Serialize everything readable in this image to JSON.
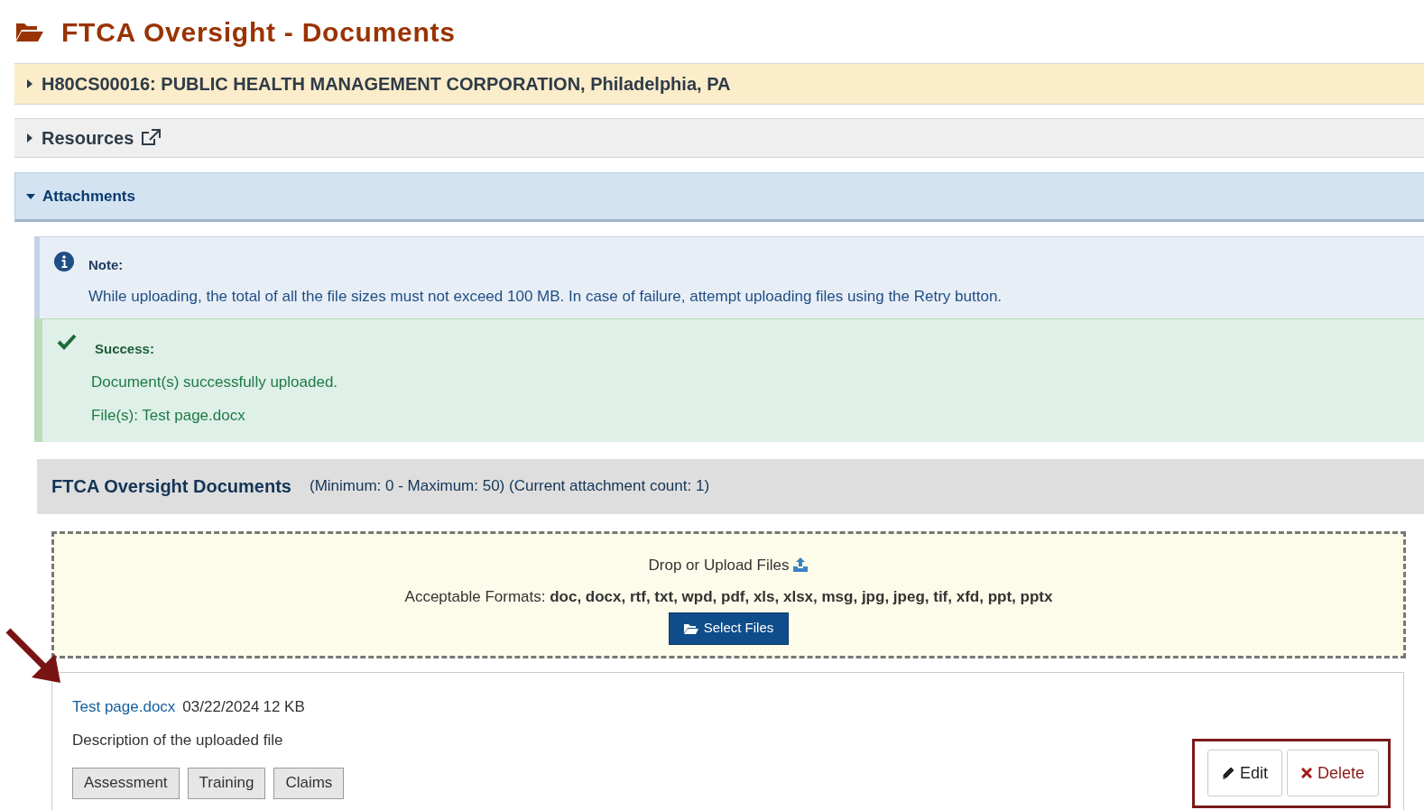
{
  "page_title": "FTCA Oversight - Documents",
  "sections": [
    {
      "kind": "org",
      "label": "H80CS00016: PUBLIC HEALTH MANAGEMENT CORPORATION, Philadelphia, PA",
      "expanded": false
    },
    {
      "kind": "resources",
      "label": "Resources",
      "expanded": false
    },
    {
      "kind": "attachments",
      "label": "Attachments",
      "expanded": true
    }
  ],
  "note": {
    "title": "Note:",
    "text": "While uploading, the total of all the file sizes must not exceed 100 MB. In case of failure, attempt uploading files using the Retry button."
  },
  "success": {
    "title": "Success:",
    "message": "Document(s) successfully uploaded.",
    "files": "File(s): Test page.docx"
  },
  "documents": {
    "title": "FTCA Oversight Documents",
    "limits": "(Minimum: 0 - Maximum: 50) (Current attachment count: 1)"
  },
  "dropzone": {
    "prompt": "Drop or Upload Files",
    "formats": "Acceptable Formats: **doc, docx, rtf, txt, wpd, pdf, xls, xlsx, msg, jpg, jpeg, tif, xfd, ppt, pptx**",
    "button": "Select Files"
  },
  "file": {
    "name": "Test page.docx",
    "date": "03/22/2024",
    "size": "12 KB",
    "description": "Description of the uploaded file",
    "tags": [
      "Assessment",
      "Training",
      "Claims"
    ],
    "edit": "Edit",
    "delete": "Delete"
  }
}
